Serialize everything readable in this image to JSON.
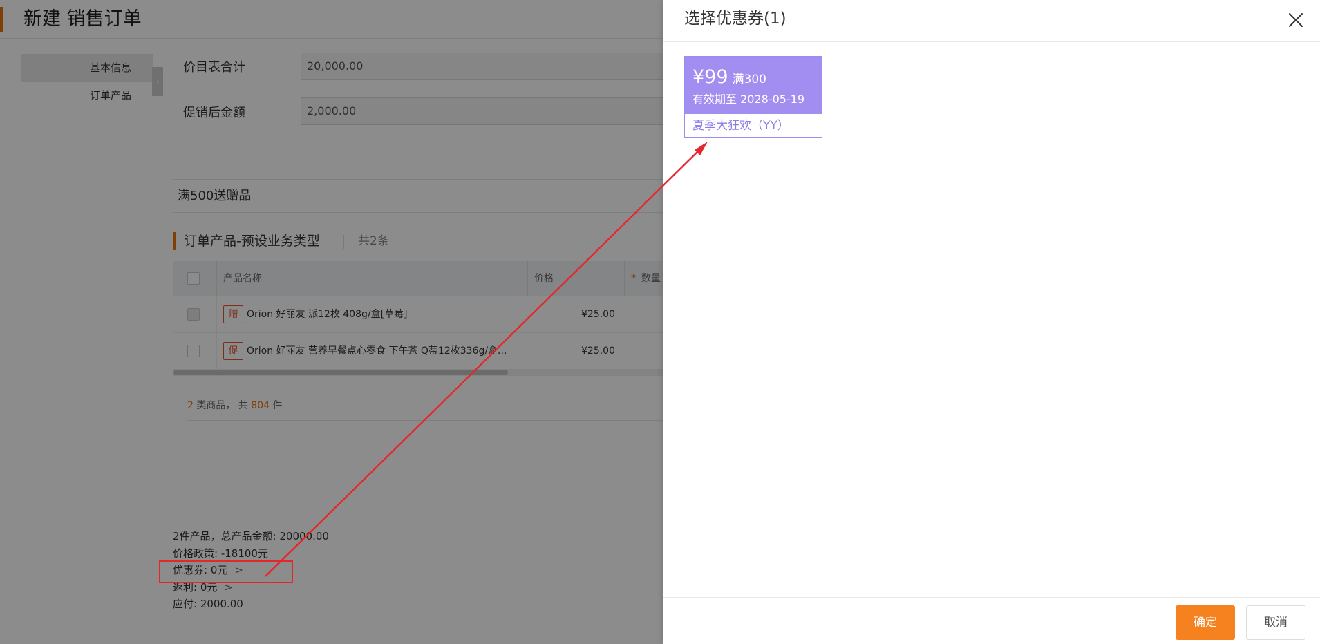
{
  "page": {
    "title": "新建 销售订单",
    "side_nav": [
      "基本信息",
      "订单产品"
    ],
    "side_toggle_glyph": "‹",
    "fields": [
      {
        "label": "价目表合计",
        "value": "20,000.00"
      },
      {
        "label": "促销后金额",
        "value": "2,000.00"
      }
    ],
    "promo_text": "满500送赠品",
    "section": {
      "title": "订单产品-预设业务类型",
      "count": "共2条"
    },
    "table": {
      "headers": {
        "name": "产品名称",
        "price": "价格",
        "qty": "数量",
        "required_mark": "*"
      },
      "rows": [
        {
          "tag": "赠",
          "name": "Orion 好丽友 派12枚 408g/盒[草莓]",
          "price": "¥25.00"
        },
        {
          "tag": "促",
          "name": "Orion 好丽友 营养早餐点心零食 下午茶 Q蒂12枚336g/盒...",
          "price": "¥25.00"
        }
      ]
    },
    "summary": {
      "count_categories": "2",
      "mid_text": " 类商品， 共 ",
      "count_items": "804",
      "end_text": " 件"
    },
    "totals": [
      {
        "text": "2件产品，总产品金额: 20000.00",
        "chevron": ""
      },
      {
        "text": "价格政策: -18100元",
        "chevron": ""
      },
      {
        "text": "优惠券: 0元",
        "chevron": ">"
      },
      {
        "text": "返利: 0元",
        "chevron": ">"
      },
      {
        "text": "应付: 2000.00",
        "chevron": ""
      }
    ]
  },
  "drawer": {
    "title": "选择优惠券(1)",
    "coupon": {
      "amount": "¥99",
      "condition": "满300",
      "valid": "有效期至 2028-05-19",
      "name": "夏季大狂欢（YY）"
    },
    "confirm_label": "确定",
    "cancel_label": "取消"
  },
  "colors": {
    "accent": "#e8740c",
    "coupon": "#a18ef0",
    "confirm": "#f5821f",
    "annotation": "#e5272b"
  }
}
